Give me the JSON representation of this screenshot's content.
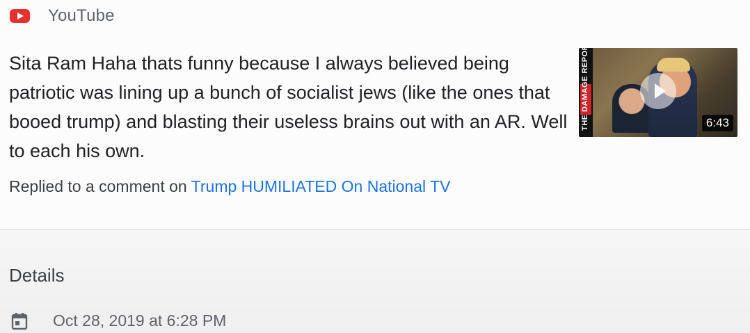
{
  "source": {
    "name": "YouTube",
    "logo_icon": "youtube-logo-icon",
    "logo_color": "#e5322d"
  },
  "comment": {
    "text": "Sita Ram Haha thats funny because I always believed being patriotic was lining up a bunch of socialist jews (like the ones that booed trump) and blasting their useless brains out with an AR. Well to each his own."
  },
  "reply": {
    "prefix": "Replied to a comment on ",
    "video_title": "Trump HUMILIATED On National TV",
    "link_color": "#1a73e8"
  },
  "thumbnail": {
    "banner_text": "THE DAMAGE REPORT",
    "duration": "6:43",
    "play_icon": "play-icon"
  },
  "details": {
    "heading": "Details",
    "date_icon": "calendar-icon",
    "date": "Oct 28, 2019 at 6:28 PM"
  }
}
